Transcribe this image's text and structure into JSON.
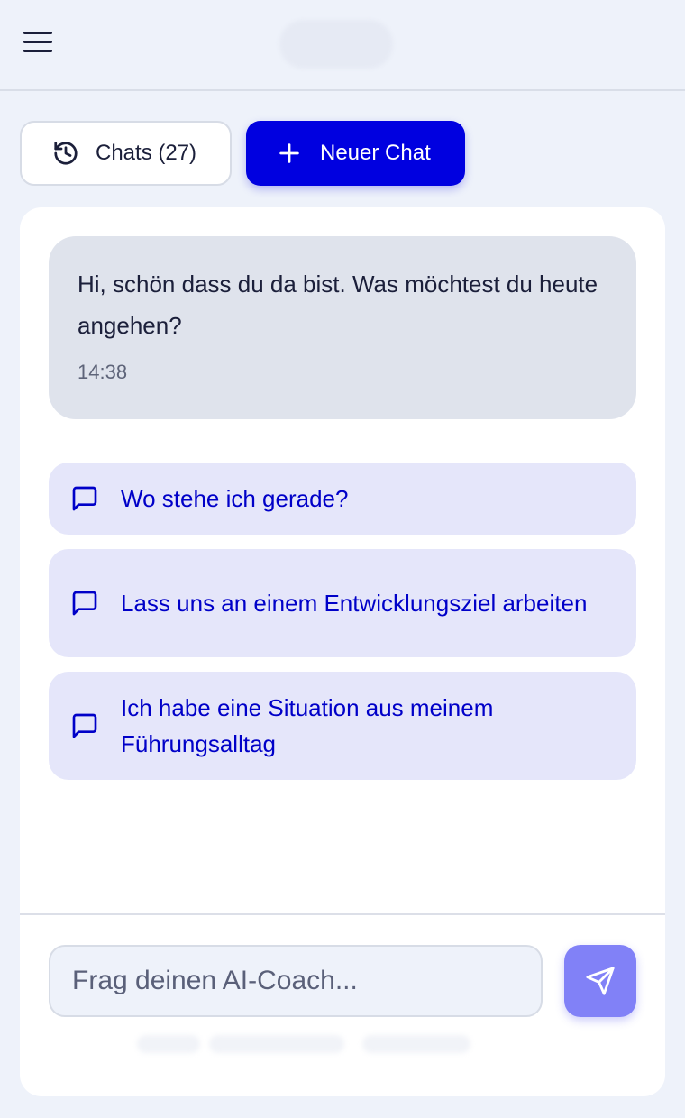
{
  "header": {
    "menu_icon": "hamburger-menu-icon"
  },
  "toolbar": {
    "chats_label": "Chats (27)",
    "chats_icon": "history-icon",
    "new_chat_label": "Neuer Chat",
    "new_chat_icon": "plus-icon"
  },
  "conversation": {
    "messages": [
      {
        "text": "Hi, schön dass du da bist. Was möchtest du heute angehen?",
        "time": "14:38"
      }
    ],
    "suggestions": [
      {
        "label": "Wo stehe ich gerade?",
        "icon": "message-square-icon"
      },
      {
        "label": "Lass uns an einem Entwicklungsziel arbeiten",
        "icon": "message-square-icon"
      },
      {
        "label": "Ich habe eine Situation aus meinem Führungsalltag",
        "icon": "message-square-icon"
      }
    ]
  },
  "composer": {
    "placeholder": "Frag deinen AI-Coach...",
    "value": "",
    "send_icon": "send-icon"
  },
  "colors": {
    "accent": "#0000e0",
    "suggestion_bg": "#e5e6fa",
    "suggestion_text": "#0000c8",
    "bubble_bg": "#dfe3ec",
    "send_button": "#8181f7",
    "page_bg": "#eef2fa"
  }
}
